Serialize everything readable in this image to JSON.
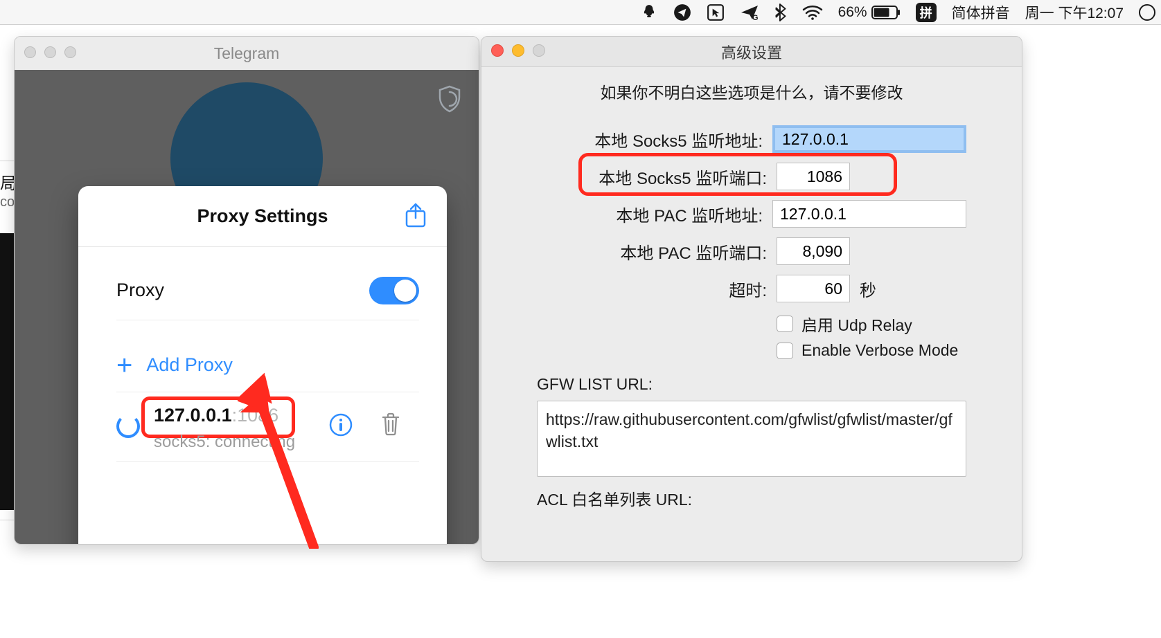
{
  "menubar": {
    "battery_percent": "66%",
    "ime_box": "拼",
    "ime_label": "简体拼音",
    "clock": "周一 下午12:07"
  },
  "telegram": {
    "window_title": "Telegram",
    "popup": {
      "title": "Proxy Settings",
      "proxy_label": "Proxy",
      "proxy_on": true,
      "add_proxy_label": "Add Proxy",
      "entry_ip": "127.0.0.1",
      "entry_port_suffix": ":1086",
      "entry_status": "socks5: connecting"
    }
  },
  "left_fragment": {
    "line1": "局",
    "line2": "co"
  },
  "advanced": {
    "title": "高级设置",
    "warning": "如果你不明白这些选项是什么，请不要修改",
    "socks5_addr_label": "本地 Socks5 监听地址:",
    "socks5_addr_value": "127.0.0.1",
    "socks5_port_label": "本地 Socks5 监听端口:",
    "socks5_port_value": "1086",
    "pac_addr_label": "本地 PAC 监听地址:",
    "pac_addr_value": "127.0.0.1",
    "pac_port_label": "本地 PAC 监听端口:",
    "pac_port_value": "8,090",
    "timeout_label": "超时:",
    "timeout_value": "60",
    "timeout_unit": "秒",
    "udp_relay_label": "启用 Udp Relay",
    "verbose_label": "Enable Verbose Mode",
    "gfw_label": "GFW LIST URL:",
    "gfw_value": "https://raw.githubusercontent.com/gfwlist/gfwlist/master/gfwlist.txt",
    "acl_label": "ACL 白名单列表 URL:"
  }
}
